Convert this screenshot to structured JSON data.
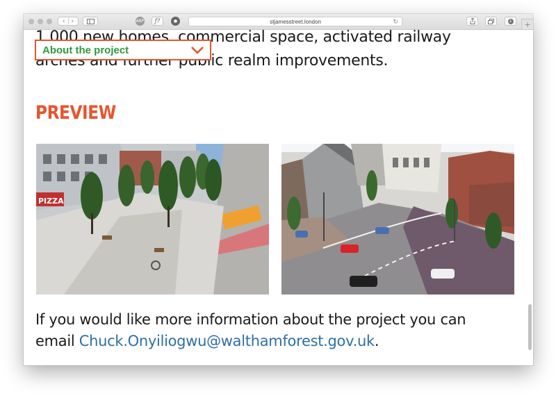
{
  "browser": {
    "url": "stjamesstreet.london",
    "back_icon": "chevron-left-icon",
    "forward_icon": "chevron-right-icon"
  },
  "page": {
    "intro_text": "1,000 new homes, commercial space, activated railway arches and further public realm improvements.",
    "nav_dropdown_label": "About the project",
    "preview_heading": "PREVIEW",
    "info_text": "If you would like more information about the project you can email ",
    "email": "Chuck.Onyiliogwu@walthamforest.gov.uk",
    "info_suffix": ".",
    "images": [
      {
        "name": "street-render-plaza"
      },
      {
        "name": "street-render-junction"
      }
    ]
  },
  "colors": {
    "accent_orange": "#e8542d",
    "accent_green": "#2e9a3f",
    "link_blue": "#2f6ea8"
  }
}
